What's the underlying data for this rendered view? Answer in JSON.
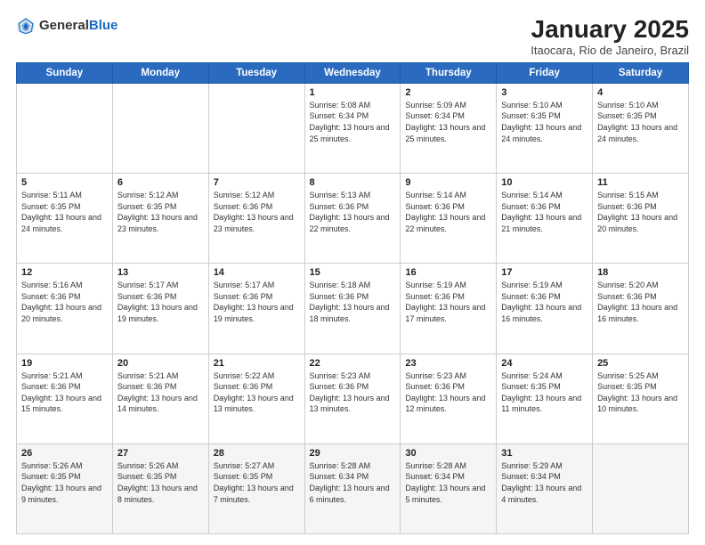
{
  "logo": {
    "general": "General",
    "blue": "Blue"
  },
  "title": "January 2025",
  "subtitle": "Itaocara, Rio de Janeiro, Brazil",
  "weekdays": [
    "Sunday",
    "Monday",
    "Tuesday",
    "Wednesday",
    "Thursday",
    "Friday",
    "Saturday"
  ],
  "weeks": [
    [
      {
        "day": "",
        "info": ""
      },
      {
        "day": "",
        "info": ""
      },
      {
        "day": "",
        "info": ""
      },
      {
        "day": "1",
        "info": "Sunrise: 5:08 AM\nSunset: 6:34 PM\nDaylight: 13 hours and 25 minutes."
      },
      {
        "day": "2",
        "info": "Sunrise: 5:09 AM\nSunset: 6:34 PM\nDaylight: 13 hours and 25 minutes."
      },
      {
        "day": "3",
        "info": "Sunrise: 5:10 AM\nSunset: 6:35 PM\nDaylight: 13 hours and 24 minutes."
      },
      {
        "day": "4",
        "info": "Sunrise: 5:10 AM\nSunset: 6:35 PM\nDaylight: 13 hours and 24 minutes."
      }
    ],
    [
      {
        "day": "5",
        "info": "Sunrise: 5:11 AM\nSunset: 6:35 PM\nDaylight: 13 hours and 24 minutes."
      },
      {
        "day": "6",
        "info": "Sunrise: 5:12 AM\nSunset: 6:35 PM\nDaylight: 13 hours and 23 minutes."
      },
      {
        "day": "7",
        "info": "Sunrise: 5:12 AM\nSunset: 6:36 PM\nDaylight: 13 hours and 23 minutes."
      },
      {
        "day": "8",
        "info": "Sunrise: 5:13 AM\nSunset: 6:36 PM\nDaylight: 13 hours and 22 minutes."
      },
      {
        "day": "9",
        "info": "Sunrise: 5:14 AM\nSunset: 6:36 PM\nDaylight: 13 hours and 22 minutes."
      },
      {
        "day": "10",
        "info": "Sunrise: 5:14 AM\nSunset: 6:36 PM\nDaylight: 13 hours and 21 minutes."
      },
      {
        "day": "11",
        "info": "Sunrise: 5:15 AM\nSunset: 6:36 PM\nDaylight: 13 hours and 20 minutes."
      }
    ],
    [
      {
        "day": "12",
        "info": "Sunrise: 5:16 AM\nSunset: 6:36 PM\nDaylight: 13 hours and 20 minutes."
      },
      {
        "day": "13",
        "info": "Sunrise: 5:17 AM\nSunset: 6:36 PM\nDaylight: 13 hours and 19 minutes."
      },
      {
        "day": "14",
        "info": "Sunrise: 5:17 AM\nSunset: 6:36 PM\nDaylight: 13 hours and 19 minutes."
      },
      {
        "day": "15",
        "info": "Sunrise: 5:18 AM\nSunset: 6:36 PM\nDaylight: 13 hours and 18 minutes."
      },
      {
        "day": "16",
        "info": "Sunrise: 5:19 AM\nSunset: 6:36 PM\nDaylight: 13 hours and 17 minutes."
      },
      {
        "day": "17",
        "info": "Sunrise: 5:19 AM\nSunset: 6:36 PM\nDaylight: 13 hours and 16 minutes."
      },
      {
        "day": "18",
        "info": "Sunrise: 5:20 AM\nSunset: 6:36 PM\nDaylight: 13 hours and 16 minutes."
      }
    ],
    [
      {
        "day": "19",
        "info": "Sunrise: 5:21 AM\nSunset: 6:36 PM\nDaylight: 13 hours and 15 minutes."
      },
      {
        "day": "20",
        "info": "Sunrise: 5:21 AM\nSunset: 6:36 PM\nDaylight: 13 hours and 14 minutes."
      },
      {
        "day": "21",
        "info": "Sunrise: 5:22 AM\nSunset: 6:36 PM\nDaylight: 13 hours and 13 minutes."
      },
      {
        "day": "22",
        "info": "Sunrise: 5:23 AM\nSunset: 6:36 PM\nDaylight: 13 hours and 13 minutes."
      },
      {
        "day": "23",
        "info": "Sunrise: 5:23 AM\nSunset: 6:36 PM\nDaylight: 13 hours and 12 minutes."
      },
      {
        "day": "24",
        "info": "Sunrise: 5:24 AM\nSunset: 6:35 PM\nDaylight: 13 hours and 11 minutes."
      },
      {
        "day": "25",
        "info": "Sunrise: 5:25 AM\nSunset: 6:35 PM\nDaylight: 13 hours and 10 minutes."
      }
    ],
    [
      {
        "day": "26",
        "info": "Sunrise: 5:26 AM\nSunset: 6:35 PM\nDaylight: 13 hours and 9 minutes."
      },
      {
        "day": "27",
        "info": "Sunrise: 5:26 AM\nSunset: 6:35 PM\nDaylight: 13 hours and 8 minutes."
      },
      {
        "day": "28",
        "info": "Sunrise: 5:27 AM\nSunset: 6:35 PM\nDaylight: 13 hours and 7 minutes."
      },
      {
        "day": "29",
        "info": "Sunrise: 5:28 AM\nSunset: 6:34 PM\nDaylight: 13 hours and 6 minutes."
      },
      {
        "day": "30",
        "info": "Sunrise: 5:28 AM\nSunset: 6:34 PM\nDaylight: 13 hours and 5 minutes."
      },
      {
        "day": "31",
        "info": "Sunrise: 5:29 AM\nSunset: 6:34 PM\nDaylight: 13 hours and 4 minutes."
      },
      {
        "day": "",
        "info": ""
      }
    ]
  ]
}
